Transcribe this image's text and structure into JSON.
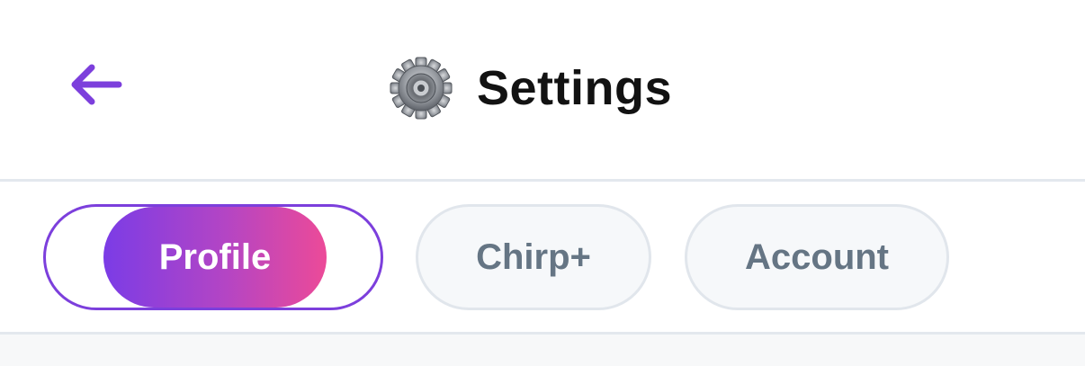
{
  "header": {
    "title": "Settings",
    "back_icon": "arrow-left-icon",
    "title_icon": "gear-icon"
  },
  "tabs": [
    {
      "label": "Profile",
      "active": true
    },
    {
      "label": "Chirp+",
      "active": false
    },
    {
      "label": "Account",
      "active": false
    }
  ],
  "colors": {
    "accent": "#7c3fdc",
    "active_gradient_start": "#7b3ce6",
    "active_gradient_end": "#ec4a98",
    "inactive_tab_text": "#657584",
    "inactive_tab_bg": "#f6f8fa",
    "title_text": "#121212"
  }
}
